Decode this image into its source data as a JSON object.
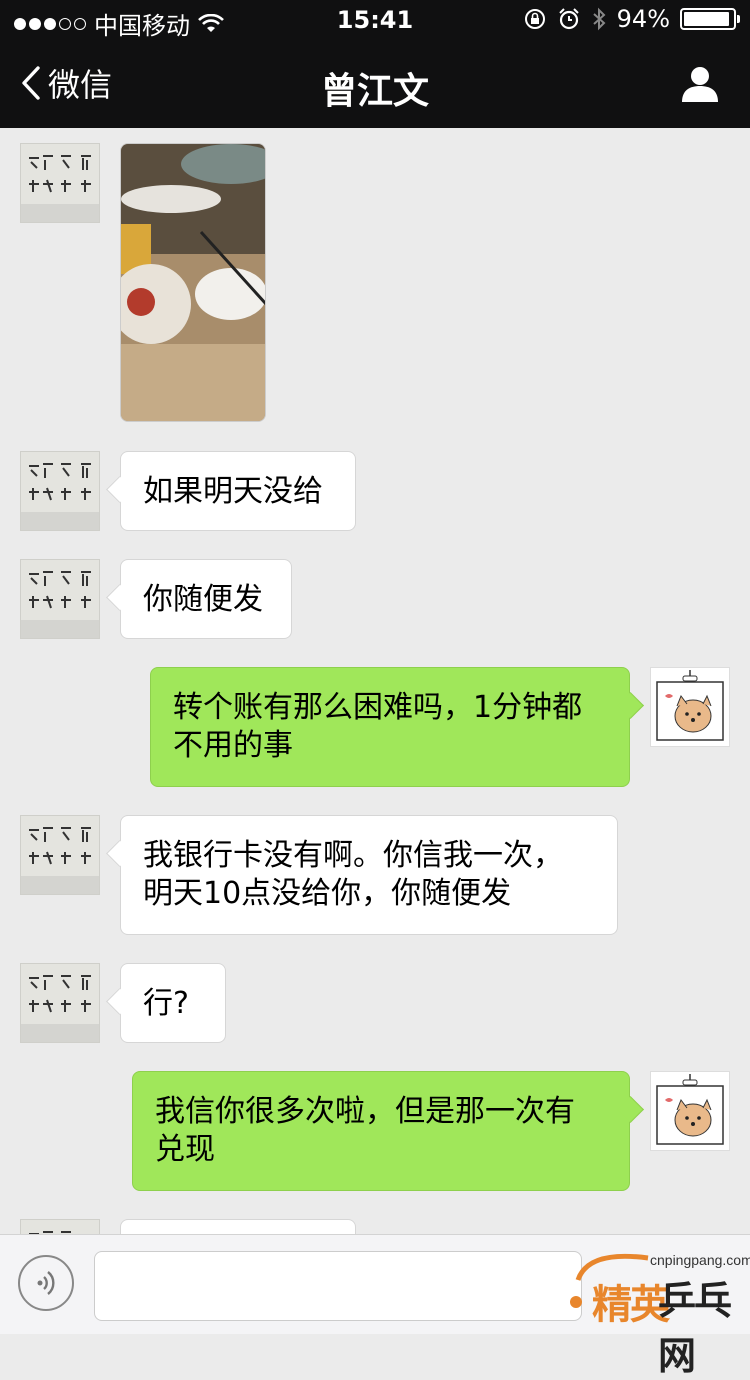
{
  "status_bar": {
    "carrier": "中国移动",
    "time": "15:41",
    "battery_text": "94%",
    "battery_level": 0.94,
    "signal_bars_filled": 3,
    "signal_bars_total": 5
  },
  "nav": {
    "back_label": "微信",
    "title": "曾江文"
  },
  "messages": [
    {
      "side": "in",
      "type": "image",
      "icon": "photo-thumbnail"
    },
    {
      "side": "in",
      "type": "text",
      "text": "如果明天没给"
    },
    {
      "side": "in",
      "type": "text",
      "text": "你随便发"
    },
    {
      "side": "out",
      "type": "text",
      "line1": "转个账有那么困难吗，1分钟都",
      "line2": "不用的事"
    },
    {
      "side": "in",
      "type": "text",
      "line1": "我银行卡没有啊。你信我一次，",
      "line2": "明天10点没给你，你随便发"
    },
    {
      "side": "in",
      "type": "text",
      "text": "行?"
    },
    {
      "side": "out",
      "type": "text",
      "line1": "我信你很多次啦，但是那一次有",
      "line2": "兑现"
    }
  ],
  "input_bar": {
    "voice_icon": "voice-icon",
    "text_value": ""
  },
  "watermark": {
    "url": "cnpingpang.com",
    "brand_a": "精英",
    "brand_b": "乒乓网"
  },
  "colors": {
    "nav_bg": "#101011",
    "chat_bg": "#ebebeb",
    "out_bubble": "#a0e75a",
    "in_bubble": "#ffffff"
  }
}
